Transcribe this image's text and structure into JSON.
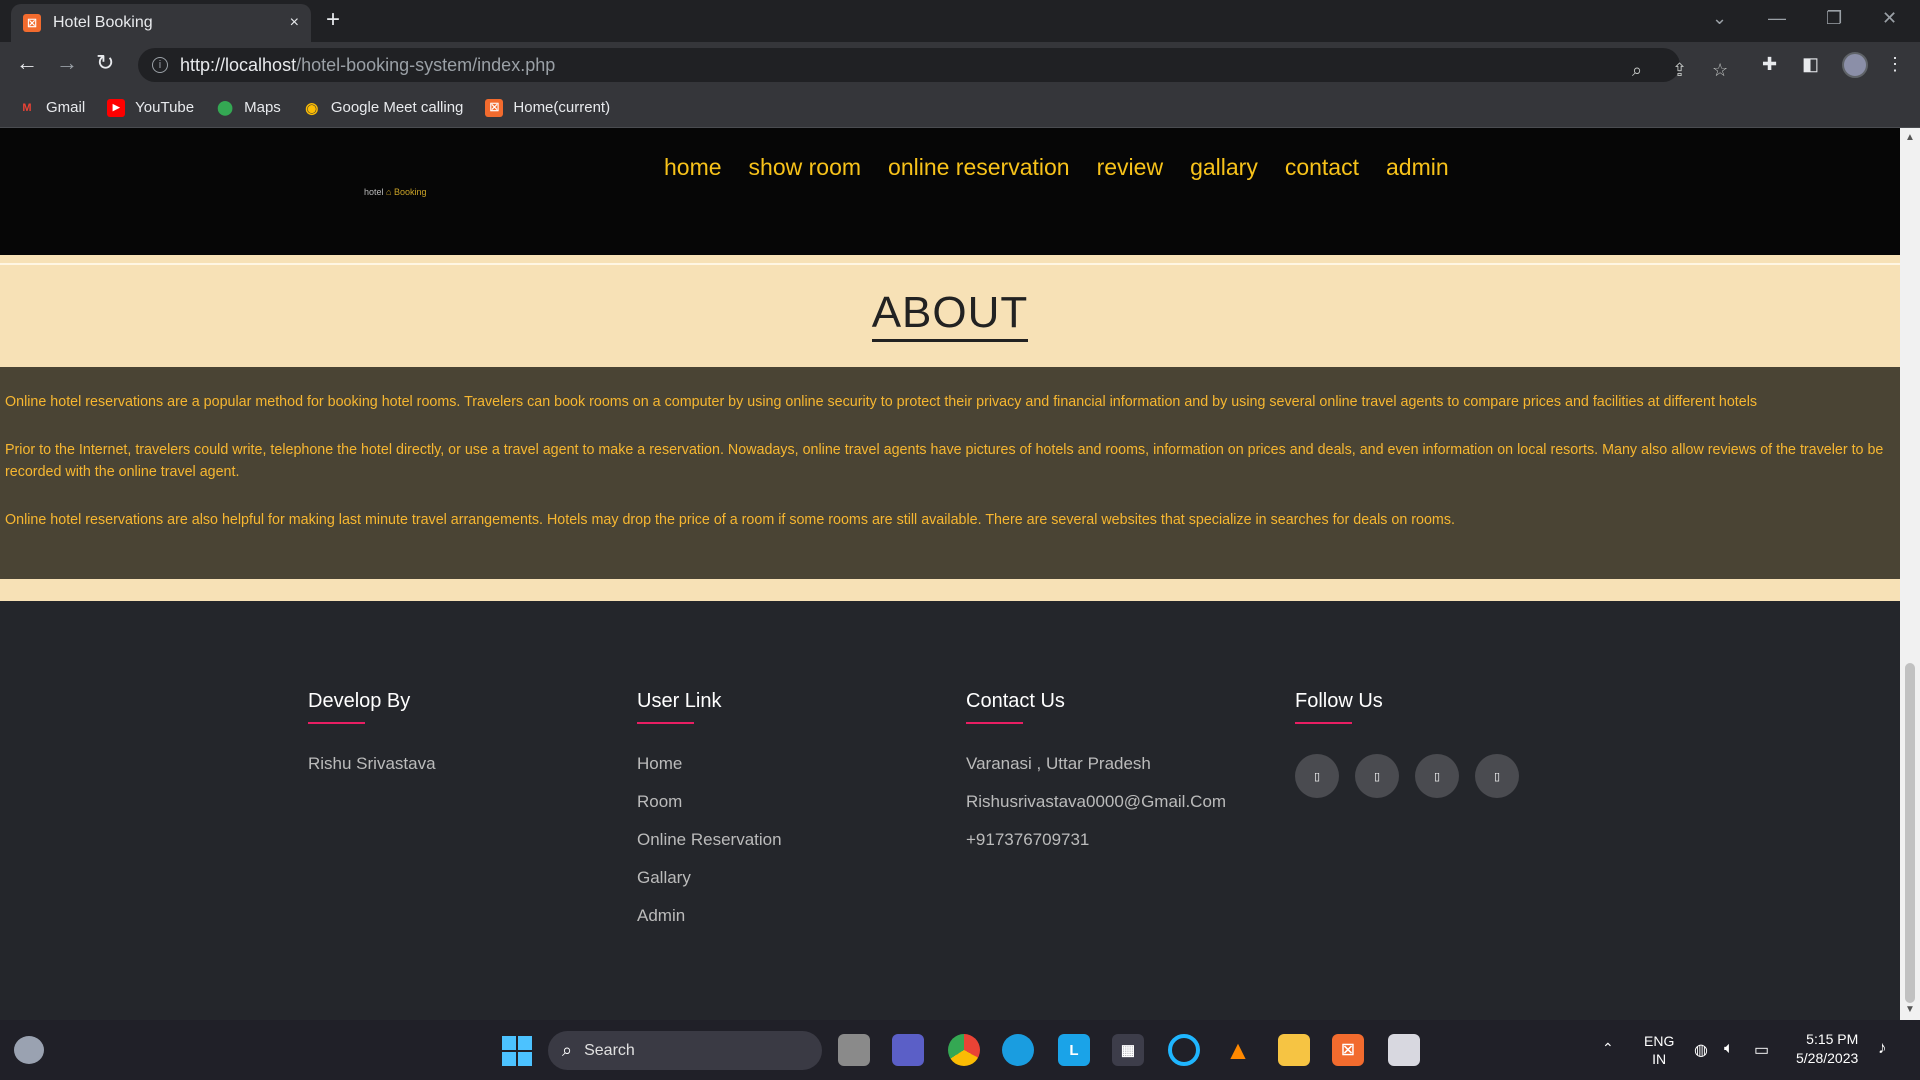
{
  "browser": {
    "tab_title": "Hotel Booking",
    "tab_close": "×",
    "new_tab": "+",
    "url_host": "http://localhost",
    "url_path": "/hotel-booking-system/index.php",
    "bookmarks": [
      {
        "label": "Gmail",
        "icon": "gmail-icon",
        "color": "#ea4335",
        "glyph": "M"
      },
      {
        "label": "YouTube",
        "icon": "youtube-icon",
        "color": "#ff0000",
        "glyph": "▶"
      },
      {
        "label": "Maps",
        "icon": "maps-icon",
        "color": "#34a853",
        "glyph": "⬤"
      },
      {
        "label": "Google Meet calling",
        "icon": "meet-icon",
        "color": "#fbbc04",
        "glyph": "◉"
      },
      {
        "label": "Home(current)",
        "icon": "xampp-icon",
        "color": "#f26b2e",
        "glyph": "☒"
      }
    ]
  },
  "site": {
    "logo_hotel": "hotel",
    "logo_booking": "Booking",
    "nav": [
      "home",
      "show room",
      "online reservation",
      "review",
      "gallary",
      "contact",
      "admin"
    ],
    "about_title": "ABOUT",
    "about_paragraphs": [
      "Online hotel reservations are a popular method for booking hotel rooms. Travelers can book rooms on a computer by using online security to protect their privacy and financial information and by using several online travel agents to compare prices and facilities at different hotels",
      "Prior to the Internet, travelers could write, telephone the hotel directly, or use a travel agent to make a reservation. Nowadays, online travel agents have pictures of hotels and rooms, information on prices and deals, and even information on local resorts. Many also allow reviews of the traveler to be recorded with the online travel agent.",
      "Online hotel reservations are also helpful for making last minute travel arrangements. Hotels may drop the price of a room if some rooms are still available. There are several websites that specialize in searches for deals on rooms."
    ],
    "footer": {
      "develop": {
        "heading": "Develop By",
        "items": [
          "Rishu Srivastava"
        ]
      },
      "userlink": {
        "heading": "User Link",
        "items": [
          "Home",
          "Room",
          "Online Reservation",
          "Gallary",
          "Admin"
        ]
      },
      "contact": {
        "heading": "Contact Us",
        "items": [
          "Varanasi , Uttar Pradesh",
          "Rishusrivastava0000@Gmail.Com",
          "+917376709731"
        ]
      },
      "follow": {
        "heading": "Follow Us",
        "icons": [
          "facebook-icon",
          "twitter-icon",
          "instagram-icon",
          "linkedin-icon"
        ],
        "glyph": "▯"
      }
    }
  },
  "taskbar": {
    "search_label": "Search",
    "lang_top": "ENG",
    "lang_bottom": "IN",
    "time": "5:15 PM",
    "date": "5/28/2023"
  },
  "colors": {
    "nav_link": "#f7c21a",
    "about_text": "#f7b731",
    "about_bg": "#4a4434",
    "page_bg": "#f7e1b6",
    "footer_bg": "#24262b",
    "footer_accent": "#e91e63"
  }
}
